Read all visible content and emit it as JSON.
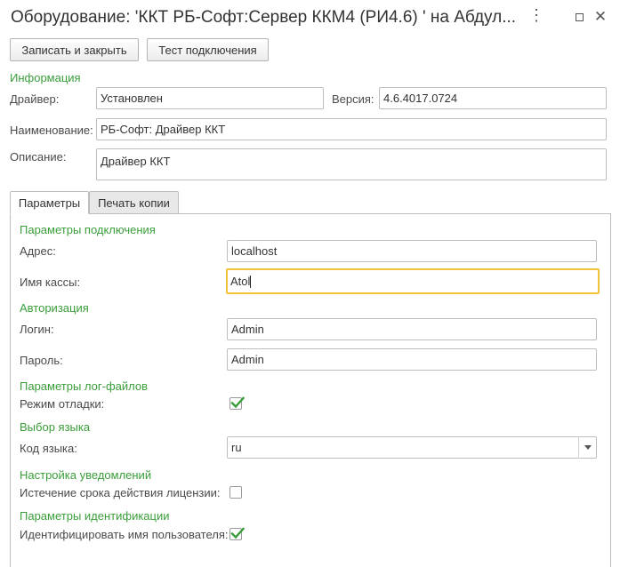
{
  "window": {
    "title": "Оборудование: 'ККТ РБ-Софт:Сервер ККМ4 (РИ4.6) ' на Абдул...",
    "more_glyph": "⋮",
    "close_glyph": "✕"
  },
  "toolbar": {
    "save_close_label": "Записать и закрыть",
    "test_label": "Тест подключения"
  },
  "info": {
    "section_title": "Информация",
    "driver_label": "Драйвер:",
    "driver_value": "Установлен",
    "version_label": "Версия:",
    "version_value": "4.6.4017.0724",
    "name_label": "Наименование:",
    "name_value": "РБ-Софт: Драйвер ККТ",
    "description_label": "Описание:",
    "description_value": "Драйвер ККТ"
  },
  "tabs": [
    {
      "label": "Параметры",
      "active": true
    },
    {
      "label": "Печать копии",
      "active": false
    }
  ],
  "params": {
    "connection_title": "Параметры подключения",
    "address_label": "Адрес:",
    "address_value": "localhost",
    "cashbox_label": "Имя кассы:",
    "cashbox_value": "Atol",
    "auth_title": "Авторизация",
    "login_label": "Логин:",
    "login_value": "Admin",
    "password_label": "Пароль:",
    "password_value": "Admin",
    "log_title": "Параметры лог-файлов",
    "debug_label": "Режим отладки:",
    "debug_checked": true,
    "lang_title": "Выбор языка",
    "lang_label": "Код языка:",
    "lang_value": "ru",
    "notify_title": "Настройка уведомлений",
    "license_label": "Истечение срока действия лицензии:",
    "license_checked": false,
    "ident_title": "Параметры идентификации",
    "ident_label": "Идентифицировать имя пользователя:",
    "ident_checked": true
  },
  "colors": {
    "section_green": "#3a9e3a",
    "check_green": "#3a9e3a",
    "focus_yellow": "#f3c43b"
  }
}
